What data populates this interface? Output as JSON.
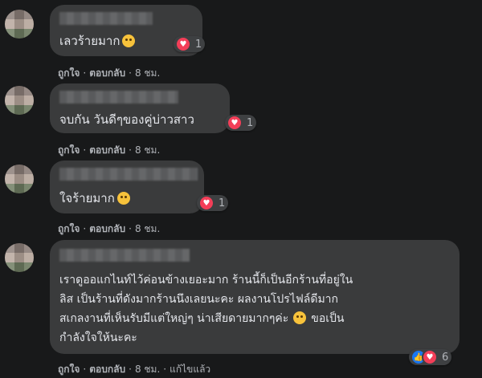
{
  "comments": [
    {
      "text": "เลวร้ายมาก",
      "reaction_count": "1",
      "actions": {
        "like": "ถูกใจ",
        "reply": "ตอบกลับ",
        "time": "8 ชม."
      }
    },
    {
      "text": "จบกัน วันดีๆของคู่บ่าวสาว",
      "reaction_count": "1",
      "actions": {
        "like": "ถูกใจ",
        "reply": "ตอบกลับ",
        "time": "8 ชม."
      }
    },
    {
      "text": "ใจร้ายมาก",
      "reaction_count": "1",
      "actions": {
        "like": "ถูกใจ",
        "reply": "ตอบกลับ",
        "time": "8 ชม."
      }
    },
    {
      "lines": [
        "เราดูออแกไนท์ไว้ค่อนข้างเยอะมาก ร้านนี้ก็เป็นอีกร้านที่อยู่ใน",
        "ลิส เป็นร้านที่ดังมากร้านนึงเลยนะคะ ผลงานโปรไฟล์ดีมาก",
        "สเกลงานที่เห็นรับมีแต่ใหญ่ๆ น่าเสียดายมากๆค่ะ",
        "ขอเป็น",
        "กำลังใจให้นะคะ"
      ],
      "reaction_count": "6",
      "actions": {
        "like": "ถูกใจ",
        "reply": "ตอบกลับ",
        "time": "8 ชม.",
        "edited": "แก้ไขแล้ว"
      }
    }
  ],
  "colors": {
    "background": "#18191a",
    "bubble": "#3a3b3c",
    "heart": "#f33e58",
    "like": "#1877f2"
  },
  "icons": {
    "heart": "heart-icon",
    "like": "thumbs-up-icon",
    "emoji": "sad-face-emoji"
  }
}
